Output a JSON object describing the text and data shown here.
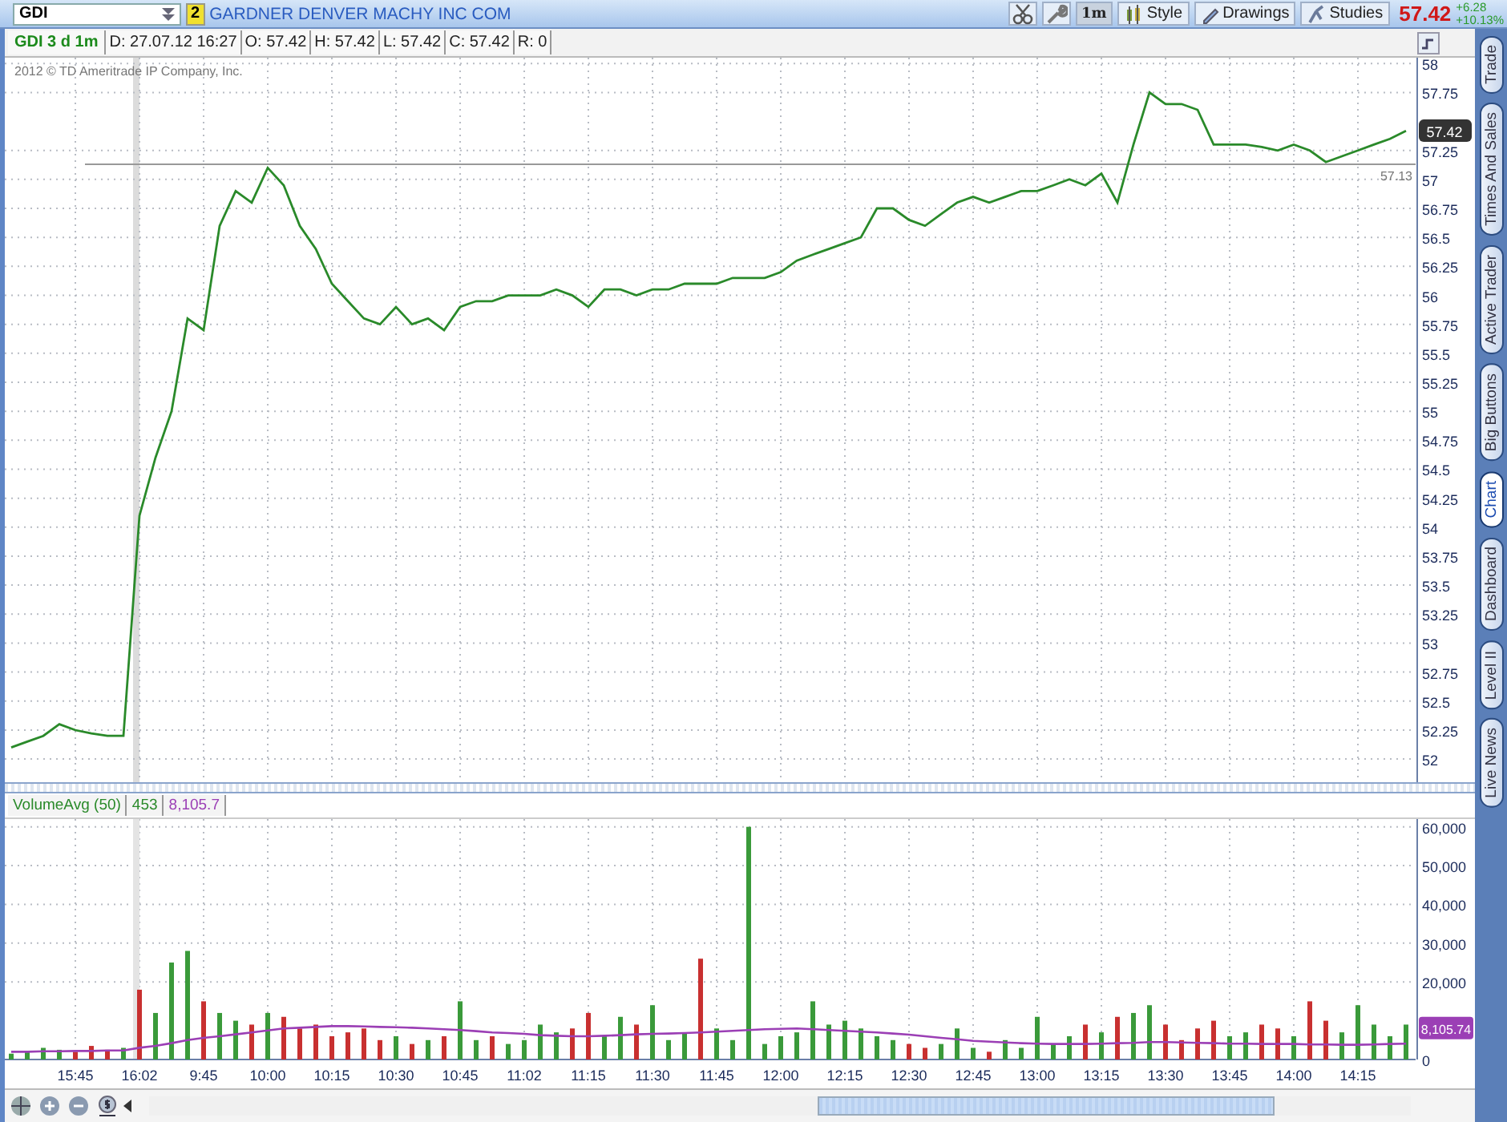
{
  "toolbar": {
    "symbol": "GDI",
    "link_badge": "2",
    "company": "GARDNER DENVER MACHY INC COM",
    "buttons": [
      {
        "kind": "scissors"
      },
      {
        "kind": "wrench"
      },
      {
        "kind": "interval",
        "label": "1m"
      },
      {
        "kind": "style",
        "label": "Style"
      },
      {
        "kind": "drawings",
        "label": "Drawings"
      },
      {
        "kind": "studies",
        "label": "Studies"
      }
    ],
    "last_price": "57.42",
    "change": "+6.28",
    "change_pct": "+10.13%"
  },
  "info_bar": [
    "GDI 3 d 1m",
    "D: 27.07.12 16:27",
    "O: 57.42",
    "H: 57.42",
    "L: 57.42",
    "C: 57.42",
    "R: 0"
  ],
  "price_chart": {
    "copyright": "2012 © TD Ameritrade IP Company, Inc.",
    "chart_data": {
      "type": "line",
      "ylim": [
        51.8,
        58.05
      ],
      "series": [
        {
          "color": "#2a8a2a",
          "values": [
            52.1,
            52.15,
            52.2,
            52.3,
            52.25,
            52.22,
            52.2,
            52.2,
            54.1,
            54.6,
            55.0,
            55.8,
            55.7,
            56.6,
            56.9,
            56.8,
            57.1,
            56.95,
            56.6,
            56.4,
            56.1,
            55.95,
            55.8,
            55.75,
            55.9,
            55.75,
            55.8,
            55.7,
            55.9,
            55.95,
            55.95,
            56.0,
            56.0,
            56.0,
            56.05,
            56.0,
            55.9,
            56.05,
            56.05,
            56.0,
            56.05,
            56.05,
            56.1,
            56.1,
            56.1,
            56.15,
            56.15,
            56.15,
            56.2,
            56.3,
            56.35,
            56.4,
            56.45,
            56.5,
            56.75,
            56.75,
            56.65,
            56.6,
            56.7,
            56.8,
            56.85,
            56.8,
            56.85,
            56.9,
            56.9,
            56.95,
            57.0,
            56.95,
            57.05,
            56.8,
            57.3,
            57.75,
            57.65,
            57.65,
            57.6,
            57.3,
            57.3,
            57.3,
            57.28,
            57.25,
            57.3,
            57.25,
            57.15,
            57.2,
            57.25,
            57.3,
            57.35,
            57.42
          ]
        }
      ],
      "yticks": [
        {
          "value": 52,
          "label": "52"
        },
        {
          "value": 52.25,
          "label": "52.25"
        },
        {
          "value": 52.5,
          "label": "52.5"
        },
        {
          "value": 52.75,
          "label": "52.75"
        },
        {
          "value": 53,
          "label": "53"
        },
        {
          "value": 53.25,
          "label": "53.25"
        },
        {
          "value": 53.5,
          "label": "53.5"
        },
        {
          "value": 53.75,
          "label": "53.75"
        },
        {
          "value": 54,
          "label": "54"
        },
        {
          "value": 54.25,
          "label": "54.25"
        },
        {
          "value": 54.5,
          "label": "54.5"
        },
        {
          "value": 54.75,
          "label": "54.75"
        },
        {
          "value": 55,
          "label": "55"
        },
        {
          "value": 55.25,
          "label": "55.25"
        },
        {
          "value": 55.5,
          "label": "55.5"
        },
        {
          "value": 55.75,
          "label": "55.75"
        },
        {
          "value": 56,
          "label": "56"
        },
        {
          "value": 56.25,
          "label": "56.25"
        },
        {
          "value": 56.5,
          "label": "56.5"
        },
        {
          "value": 56.75,
          "label": "56.75"
        },
        {
          "value": 57,
          "label": "57"
        },
        {
          "value": 57.25,
          "label": "57.25"
        },
        {
          "value": 57.75,
          "label": "57.75"
        },
        {
          "value": 58,
          "label": "58"
        }
      ],
      "grid": true,
      "ref_lines": [
        {
          "axis": "y",
          "value": 57.13,
          "label": "57.13"
        }
      ],
      "annotations": [
        {
          "y": 57.42,
          "text": "57.42"
        }
      ]
    }
  },
  "volume_chart": {
    "header": [
      "VolumeAvg (50)",
      "453",
      "8,105.7"
    ],
    "chart_data": {
      "type": "bar",
      "ylim": [
        0,
        62000
      ],
      "grid": true,
      "categories": [
        null,
        null,
        null,
        null,
        "15:45",
        null,
        null,
        null,
        "16:02",
        null,
        null,
        null,
        "9:45",
        null,
        null,
        null,
        "10:00",
        null,
        null,
        null,
        "10:15",
        null,
        null,
        null,
        "10:30",
        null,
        null,
        null,
        "10:45",
        null,
        null,
        null,
        "11:02",
        null,
        null,
        null,
        "11:15",
        null,
        null,
        null,
        "11:30",
        null,
        null,
        null,
        "11:45",
        null,
        null,
        null,
        "12:00",
        null,
        null,
        null,
        "12:15",
        null,
        null,
        null,
        "12:30",
        null,
        null,
        null,
        "12:45",
        null,
        null,
        null,
        "13:00",
        null,
        null,
        null,
        "13:15",
        null,
        null,
        null,
        "13:30",
        null,
        null,
        null,
        "13:45",
        null,
        null,
        null,
        "14:00",
        null,
        null,
        null,
        "14:15",
        null,
        null,
        null
      ],
      "series": [
        {
          "color": "#3a9a3a",
          "values": [
            1500,
            2000,
            3000,
            2500,
            null,
            null,
            null,
            3000,
            null,
            12000,
            25000,
            28000,
            null,
            12000,
            10000,
            null,
            12000,
            null,
            null,
            null,
            null,
            null,
            null,
            null,
            6000,
            null,
            5000,
            null,
            15000,
            5000,
            null,
            4000,
            5000,
            9000,
            7000,
            null,
            null,
            6000,
            11000,
            null,
            14000,
            5000,
            7000,
            null,
            8000,
            5000,
            60000,
            4000,
            6000,
            7000,
            15000,
            9000,
            10000,
            8000,
            6000,
            5000,
            null,
            null,
            4000,
            8000,
            3000,
            null,
            5000,
            3000,
            11000,
            4000,
            6000,
            null,
            7000,
            null,
            12000,
            14000,
            null,
            null,
            null,
            null,
            6000,
            7000,
            null,
            null,
            6000,
            null,
            null,
            7000,
            14000,
            9000,
            6000,
            9000
          ]
        },
        {
          "color": "#c83030",
          "values": [
            null,
            null,
            null,
            null,
            2000,
            3500,
            2500,
            null,
            18000,
            null,
            null,
            null,
            15000,
            null,
            null,
            9000,
            null,
            11000,
            8000,
            9000,
            6000,
            7000,
            8000,
            5000,
            null,
            4000,
            null,
            6000,
            null,
            null,
            6000,
            null,
            null,
            null,
            null,
            8000,
            12000,
            null,
            null,
            9000,
            null,
            null,
            null,
            26000,
            null,
            null,
            null,
            null,
            null,
            null,
            null,
            null,
            null,
            null,
            null,
            null,
            4000,
            3000,
            null,
            null,
            null,
            2000,
            null,
            null,
            null,
            null,
            null,
            9000,
            null,
            11000,
            null,
            null,
            9000,
            5000,
            8000,
            10000,
            null,
            null,
            9000,
            8000,
            null,
            15000,
            10000,
            null,
            null,
            null,
            null,
            null
          ]
        },
        {
          "type": "line",
          "color": "#9b3fb5",
          "values": [
            2000,
            2000,
            2100,
            2100,
            2200,
            2200,
            2300,
            2300,
            3000,
            3500,
            4200,
            5000,
            5600,
            6000,
            6500,
            7000,
            7500,
            8000,
            8200,
            8400,
            8600,
            8600,
            8500,
            8400,
            8300,
            8200,
            8000,
            7800,
            7600,
            7300,
            7000,
            6800,
            6600,
            6300,
            6100,
            6000,
            6000,
            6100,
            6300,
            6500,
            6600,
            6700,
            6800,
            7000,
            7200,
            7400,
            7600,
            7800,
            7900,
            8000,
            7800,
            7600,
            7400,
            7200,
            7000,
            6700,
            6400,
            6000,
            5600,
            5200,
            4800,
            4600,
            4400,
            4200,
            4100,
            4000,
            4000,
            4000,
            4100,
            4200,
            4300,
            4500,
            4500,
            4400,
            4300,
            4200,
            4100,
            4100,
            4000,
            4000,
            4000,
            3900,
            3900,
            3800,
            3800,
            3900,
            4000,
            4100
          ]
        }
      ],
      "yticks": [
        {
          "value": 0,
          "label": "0"
        },
        {
          "value": 20000,
          "label": "20,000"
        },
        {
          "value": 30000,
          "label": "30,000"
        },
        {
          "value": 40000,
          "label": "40,000"
        },
        {
          "value": 50000,
          "label": "50,000"
        },
        {
          "value": 60000,
          "label": "60,000"
        }
      ],
      "annotations": [
        {
          "y": 8105.74,
          "text": "8,105.74"
        }
      ]
    }
  },
  "side_tabs": [
    {
      "label": "Trade",
      "selected": false
    },
    {
      "label": "Times And Sales",
      "selected": false
    },
    {
      "label": "Active Trader",
      "selected": false
    },
    {
      "label": "Big Buttons",
      "selected": false
    },
    {
      "label": "Chart",
      "selected": true
    },
    {
      "label": "Dashboard",
      "selected": false
    },
    {
      "label": "Level II",
      "selected": false
    },
    {
      "label": "Live News",
      "selected": false
    }
  ]
}
